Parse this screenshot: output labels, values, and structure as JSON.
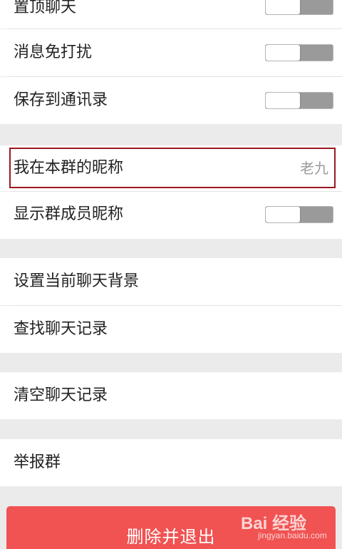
{
  "settings": {
    "group1": {
      "pin_chat_label": "置顶聊天",
      "mute_label": "消息免打扰",
      "save_contacts_label": "保存到通讯录"
    },
    "group2": {
      "nickname_label": "我在本群的昵称",
      "nickname_value": "老九",
      "show_member_nicknames_label": "显示群成员昵称"
    },
    "group3": {
      "set_background_label": "设置当前聊天背景",
      "find_history_label": "查找聊天记录"
    },
    "group4": {
      "clear_history_label": "清空聊天记录"
    },
    "group5": {
      "report_label": "举报群"
    },
    "toggles": {
      "pin_chat": false,
      "mute": false,
      "save_contacts": false,
      "show_member_nicknames": false
    }
  },
  "actions": {
    "delete_exit_label": "删除并退出"
  },
  "watermark": {
    "line1": "Bai 经验",
    "line2": "jingyan.baidu.com"
  },
  "colors": {
    "background": "#ebebeb",
    "row_background": "#ffffff",
    "danger_button": "#f15252",
    "highlight_border": "#9a1820",
    "toggle_off": "#9a9a9a"
  }
}
